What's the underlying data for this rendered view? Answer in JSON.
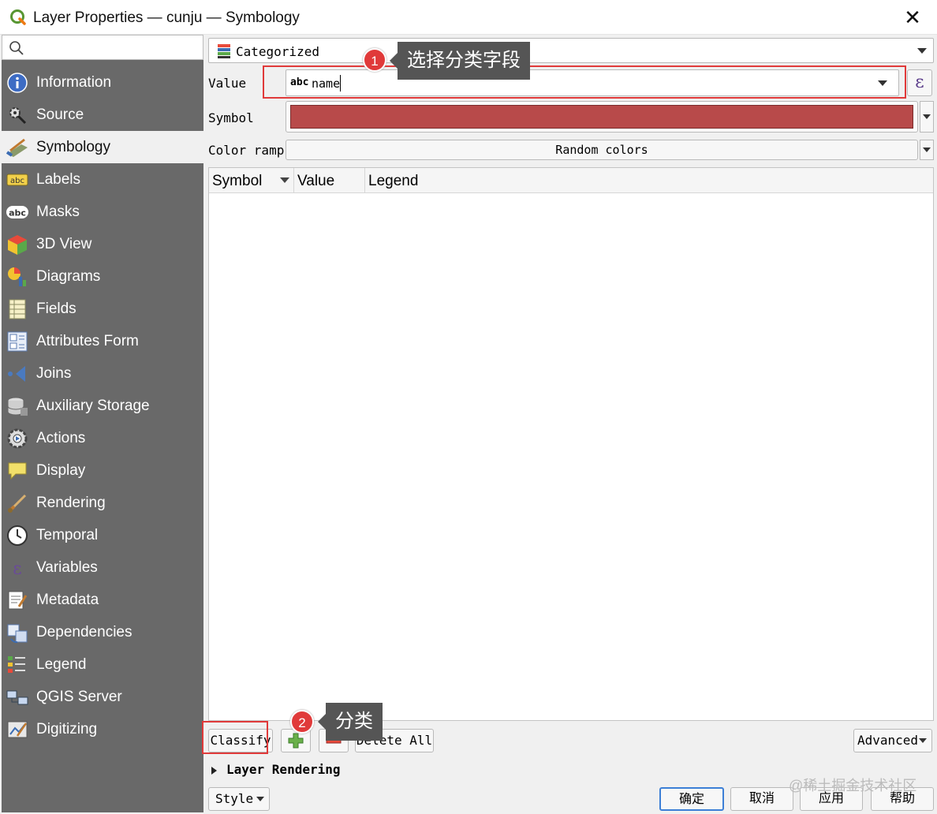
{
  "window": {
    "title": "Layer Properties — cunju — Symbology",
    "close_glyph": "✕"
  },
  "sidebar": {
    "search_placeholder": "",
    "items": [
      {
        "label": "Information",
        "icon": "info-icon"
      },
      {
        "label": "Source",
        "icon": "source-icon"
      },
      {
        "label": "Symbology",
        "icon": "symbology-icon",
        "active": true
      },
      {
        "label": "Labels",
        "icon": "labels-icon"
      },
      {
        "label": "Masks",
        "icon": "masks-icon"
      },
      {
        "label": "3D View",
        "icon": "3d-view-icon"
      },
      {
        "label": "Diagrams",
        "icon": "diagrams-icon"
      },
      {
        "label": "Fields",
        "icon": "fields-icon"
      },
      {
        "label": "Attributes Form",
        "icon": "attributes-form-icon"
      },
      {
        "label": "Joins",
        "icon": "joins-icon"
      },
      {
        "label": "Auxiliary Storage",
        "icon": "auxiliary-storage-icon"
      },
      {
        "label": "Actions",
        "icon": "actions-icon"
      },
      {
        "label": "Display",
        "icon": "display-icon"
      },
      {
        "label": "Rendering",
        "icon": "rendering-icon"
      },
      {
        "label": "Temporal",
        "icon": "temporal-icon"
      },
      {
        "label": "Variables",
        "icon": "variables-icon"
      },
      {
        "label": "Metadata",
        "icon": "metadata-icon"
      },
      {
        "label": "Dependencies",
        "icon": "dependencies-icon"
      },
      {
        "label": "Legend",
        "icon": "legend-icon"
      },
      {
        "label": "QGIS Server",
        "icon": "qgis-server-icon"
      },
      {
        "label": "Digitizing",
        "icon": "digitizing-icon"
      }
    ]
  },
  "symbology": {
    "renderer": "Categorized",
    "value_label": "Value",
    "value_type": "abc",
    "value_field": "name",
    "expression_glyph": "ε",
    "symbol_label": "Symbol",
    "symbol_color": "#b84a4a",
    "color_ramp_label": "Color ramp",
    "color_ramp_value": "Random colors",
    "table_headers": {
      "symbol": "Symbol",
      "value": "Value",
      "legend": "Legend"
    },
    "classify_label": "Classify",
    "delete_all_label": "Delete All",
    "advanced_label": "Advanced",
    "layer_rendering_label": "Layer Rendering"
  },
  "footer": {
    "style_label": "Style",
    "ok_label": "确定",
    "cancel_label": "取消",
    "apply_label": "应用",
    "help_label": "帮助"
  },
  "annotations": {
    "step1_number": "1",
    "step1_text": "选择分类字段",
    "step2_number": "2",
    "step2_text": "分类",
    "highlight_color": "#e03a3a"
  },
  "watermark": "@稀土掘金技术社区"
}
